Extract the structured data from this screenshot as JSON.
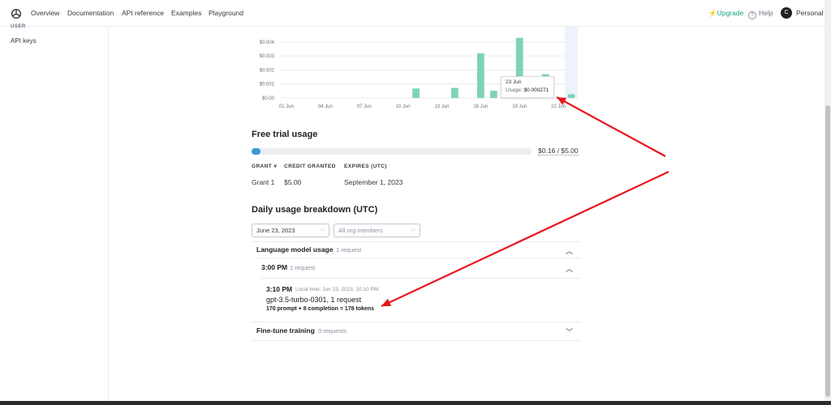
{
  "nav": {
    "links": [
      "Overview",
      "Documentation",
      "API reference",
      "Examples",
      "Playground"
    ],
    "upgrade": "Upgrade",
    "help": "Help",
    "help_glyph": "?",
    "avatar_letter": "C",
    "personal": "Personal"
  },
  "sidebar": {
    "section": "USER",
    "items": [
      "API keys"
    ]
  },
  "chart_data": {
    "type": "bar",
    "y_ticks": [
      "$0.004",
      "$0.003",
      "$0.002",
      "$0.001",
      "$0.00"
    ],
    "ylim": [
      0,
      0.0044
    ],
    "x_tick_labels": [
      "01 Jun",
      "04 Jun",
      "07 Jun",
      "10 Jun",
      "13 Jun",
      "16 Jun",
      "19 Jun",
      "22 Jun"
    ],
    "categories": [
      "01 Jun",
      "02 Jun",
      "03 Jun",
      "04 Jun",
      "05 Jun",
      "06 Jun",
      "07 Jun",
      "08 Jun",
      "09 Jun",
      "10 Jun",
      "11 Jun",
      "12 Jun",
      "13 Jun",
      "14 Jun",
      "15 Jun",
      "16 Jun",
      "17 Jun",
      "18 Jun",
      "19 Jun",
      "20 Jun",
      "21 Jun",
      "22 Jun",
      "23 Jun"
    ],
    "values": [
      0,
      0,
      0,
      0,
      0,
      0,
      0,
      0,
      0,
      0,
      0.00068,
      0,
      0,
      0.00072,
      0,
      0.0032,
      0.00052,
      0,
      0.0043,
      0,
      0.0017,
      0,
      0.000271
    ],
    "bar_color": "#7dd3b8",
    "highlight_index": 22,
    "highlight_color": "#eef3fb",
    "tooltip": {
      "date": "23 Jun",
      "label": "Usage:",
      "value": "$0.000271"
    }
  },
  "free_trial": {
    "title": "Free trial usage",
    "used_fraction": 0.032,
    "progress_label": "$0.16 / $5.00",
    "headers": [
      "GRANT #",
      "CREDIT GRANTED",
      "EXPIRES (UTC)"
    ],
    "row": [
      "Grant 1",
      "$5.00",
      "September 1, 2023"
    ]
  },
  "daily": {
    "title": "Daily usage breakdown (UTC)",
    "date_select": "June 23, 2023",
    "members_select": "All org members",
    "lm_title": "Language model usage",
    "lm_count": "1 request",
    "hour_title": "3:00 PM",
    "hour_count": "1 request",
    "req_time": "3:10 PM",
    "req_local": "Local time: Jun 23, 2023, 10:10 PM",
    "req_model": "gpt-3.5-turbo-0301, 1 request",
    "req_tokens": "170 prompt + 8 completion = 178 tokens",
    "ft_title": "Fine-tune training",
    "ft_count": "0 requests"
  },
  "colors": {
    "accent": "#10a37f",
    "progress": "#3a9ad9",
    "annotation": "#e8141b"
  }
}
